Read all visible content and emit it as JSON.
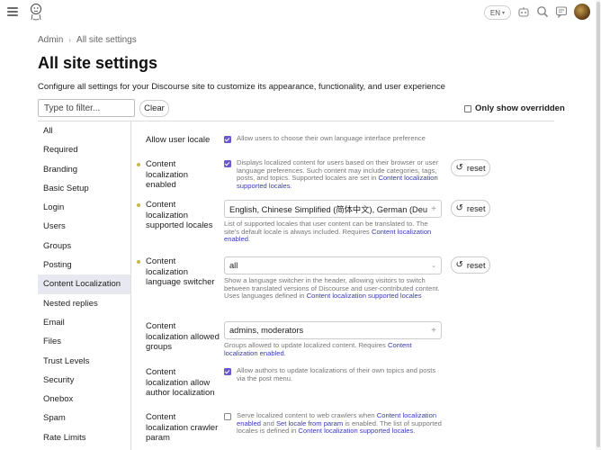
{
  "header": {
    "language": "EN"
  },
  "breadcrumb": {
    "parent": "Admin",
    "current": "All site settings"
  },
  "page": {
    "title": "All site settings",
    "description": "Configure all settings for your Discourse site to customize its appearance, functionality, and user experience"
  },
  "filter": {
    "placeholder": "Type to filter...",
    "value": "",
    "clear_label": "Clear",
    "only_overridden_label": "Only show overridden"
  },
  "sidebar": {
    "items": [
      {
        "label": "All"
      },
      {
        "label": "Required"
      },
      {
        "label": "Branding"
      },
      {
        "label": "Basic Setup"
      },
      {
        "label": "Login"
      },
      {
        "label": "Users"
      },
      {
        "label": "Groups"
      },
      {
        "label": "Posting"
      },
      {
        "label": "Content Localization"
      },
      {
        "label": "Nested replies"
      },
      {
        "label": "Email"
      },
      {
        "label": "Files"
      },
      {
        "label": "Trust Levels"
      },
      {
        "label": "Security"
      },
      {
        "label": "Onebox"
      },
      {
        "label": "Spam"
      },
      {
        "label": "Rate Limits"
      }
    ],
    "active_index": 8
  },
  "settings": {
    "reset_label": "reset",
    "allow_user_locale": {
      "label": "Allow user locale",
      "checked": true,
      "help": "Allow users to choose their own language interface preference"
    },
    "content_localization_enabled": {
      "label": "Content localization enabled",
      "checked": true,
      "help": "Displays localized content for users based on their browser or user language preferences. Such content may include categories, tags, posts, and topics. Supported locales are set in",
      "help_link": "Content localization supported locales",
      "help_end": "."
    },
    "supported_locales": {
      "label": "Content localization supported locales",
      "value": "English, Chinese Simplified (简体中文), German (Deuts...",
      "help": "List of supported locales that user content can be translated to. The site's default locale is always included. Requires",
      "help_link": "Content localization enabled",
      "help_end": "."
    },
    "language_switcher": {
      "label": "Content localization language switcher",
      "value": "all",
      "help": "Show a language switcher in the header, allowing visitors to switch between translated versions of Discourse and user-contributed content. Uses languages defined in",
      "help_link": "Content localization supported locales"
    },
    "allowed_groups": {
      "label": "Content localization allowed groups",
      "value": "admins, moderators",
      "help": "Groups allowed to update localized content. Requires",
      "help_link": "Content localization enabled",
      "help_end": "."
    },
    "allow_author": {
      "label": "Content localization allow author localization",
      "checked": true,
      "help": "Allow authors to update localizations of their own topics and posts via the post menu."
    },
    "crawler_param": {
      "label": "Content localization crawler param",
      "checked": false,
      "help_a": "Serve localized content to web crawlers when",
      "help_link1": "Content localization enabled",
      "help_b": "and",
      "help_link2": "Set locale from param",
      "help_c": "is enabled. The list of supported locales is defined in",
      "help_link3": "Content localization supported locales",
      "help_end": "."
    }
  },
  "colors": {
    "accent": "#6a5acd",
    "link": "#3a3ab8",
    "override_dot": "#c8b84a",
    "active_nav": "#e8e8f0"
  }
}
